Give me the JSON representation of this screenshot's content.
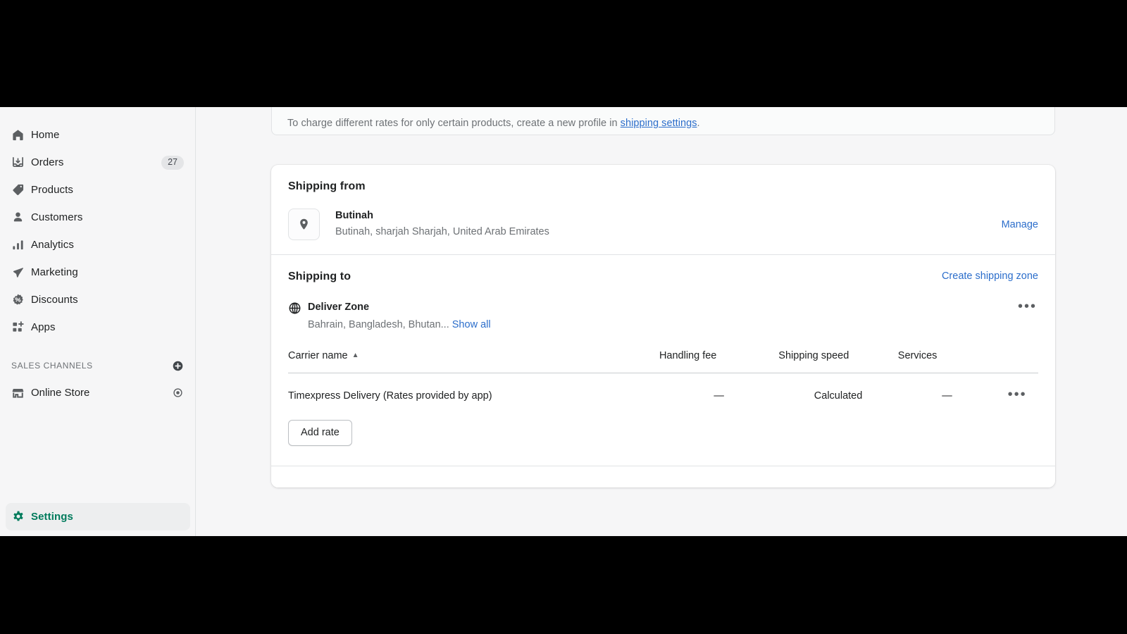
{
  "sidebar": {
    "items": [
      {
        "label": "Home",
        "icon": "home-icon",
        "badge": null
      },
      {
        "label": "Orders",
        "icon": "orders-icon",
        "badge": "27"
      },
      {
        "label": "Products",
        "icon": "products-tag-icon",
        "badge": null
      },
      {
        "label": "Customers",
        "icon": "customers-person-icon",
        "badge": null
      },
      {
        "label": "Analytics",
        "icon": "analytics-bars-icon",
        "badge": null
      },
      {
        "label": "Marketing",
        "icon": "marketing-megaphone-icon",
        "badge": null
      },
      {
        "label": "Discounts",
        "icon": "discounts-percent-icon",
        "badge": null
      },
      {
        "label": "Apps",
        "icon": "apps-grid-plus-icon",
        "badge": null
      }
    ],
    "sales_channels": {
      "heading": "SALES CHANNELS",
      "add_icon": "plus-circle-icon",
      "items": [
        {
          "label": "Online Store",
          "icon": "storefront-icon",
          "action_icon": "eye-icon"
        }
      ]
    },
    "settings": {
      "label": "Settings",
      "icon": "gear-icon",
      "active": true
    },
    "active_accent": "#007b5c"
  },
  "main": {
    "banner": {
      "text_before": "To charge different rates for only certain products, create a new profile in ",
      "link_text": "shipping settings",
      "text_after": "."
    },
    "shipping_from": {
      "title": "Shipping from",
      "location_icon": "map-pin-icon",
      "name": "Butinah",
      "address": "Butinah, sharjah Sharjah, United Arab Emirates",
      "manage_label": "Manage"
    },
    "shipping_to": {
      "title": "Shipping to",
      "create_zone_label": "Create shipping zone",
      "zone": {
        "globe_icon": "globe-icon",
        "name": "Deliver Zone",
        "countries": "Bahrain, Bangladesh, Bhutan...",
        "show_all_label": "Show all",
        "menu_icon": "ellipsis-icon"
      },
      "table": {
        "columns": [
          {
            "key": "carrier",
            "label": "Carrier name",
            "sorted": true,
            "sort_icon": "▲"
          },
          {
            "key": "fee",
            "label": "Handling fee"
          },
          {
            "key": "speed",
            "label": "Shipping speed"
          },
          {
            "key": "services",
            "label": "Services"
          }
        ],
        "rows": [
          {
            "carrier": "Timexpress Delivery (Rates provided by app)",
            "fee": "—",
            "speed": "Calculated",
            "services": "—",
            "menu_icon": "ellipsis-icon"
          }
        ]
      },
      "add_rate_label": "Add rate"
    }
  },
  "colors": {
    "link": "#2c6ecb",
    "accent_green": "#007b5c",
    "text_primary": "#202223",
    "text_subdued": "#6d7175",
    "surface": "#ffffff",
    "background": "#f6f6f7",
    "border": "#e1e3e5"
  }
}
